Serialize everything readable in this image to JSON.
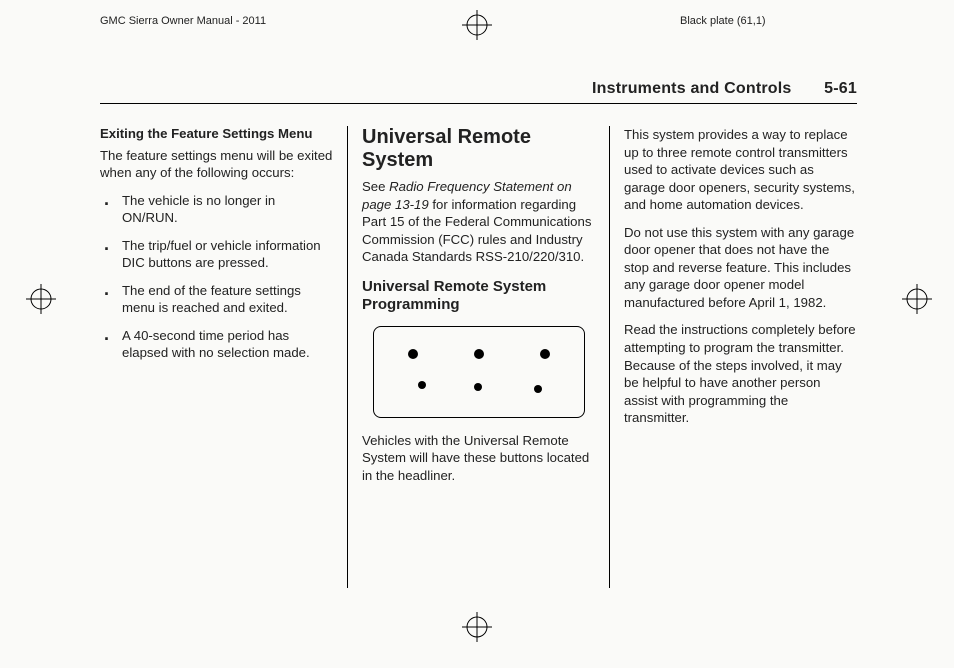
{
  "meta": {
    "left": "GMC Sierra Owner Manual - 2011",
    "right": "Black plate (61,1)"
  },
  "header": {
    "chapter": "Instruments and Controls",
    "page": "5-61"
  },
  "col1": {
    "h4": "Exiting the Feature Settings Menu",
    "intro": "The feature settings menu will be exited when any of the following occurs:",
    "bullets": [
      "The vehicle is no longer in ON/RUN.",
      "The trip/fuel or vehicle information DIC buttons are pressed.",
      "The end of the feature settings menu is reached and exited.",
      "A 40-second time period has elapsed with no selection made."
    ]
  },
  "col2": {
    "h2": "Universal Remote System",
    "p1a": "See ",
    "p1_ital": "Radio Frequency Statement on page 13-19",
    "p1b": " for information regarding Part 15 of the Federal Communications Commission (FCC) rules and Industry Canada Standards RSS-210/220/310.",
    "h3": "Universal Remote System Programming",
    "p2": "Vehicles with the Universal Remote System will have these buttons located in the headliner."
  },
  "col3": {
    "p1": "This system provides a way to replace up to three remote control transmitters used to activate devices such as garage door openers, security systems, and home automation devices.",
    "p2": "Do not use this system with any garage door opener that does not have the stop and reverse feature. This includes any garage door opener model manufactured before April 1, 1982.",
    "p3": "Read the instructions completely before attempting to program the transmitter. Because of the steps involved, it may be helpful to have another person assist with programming the transmitter."
  }
}
